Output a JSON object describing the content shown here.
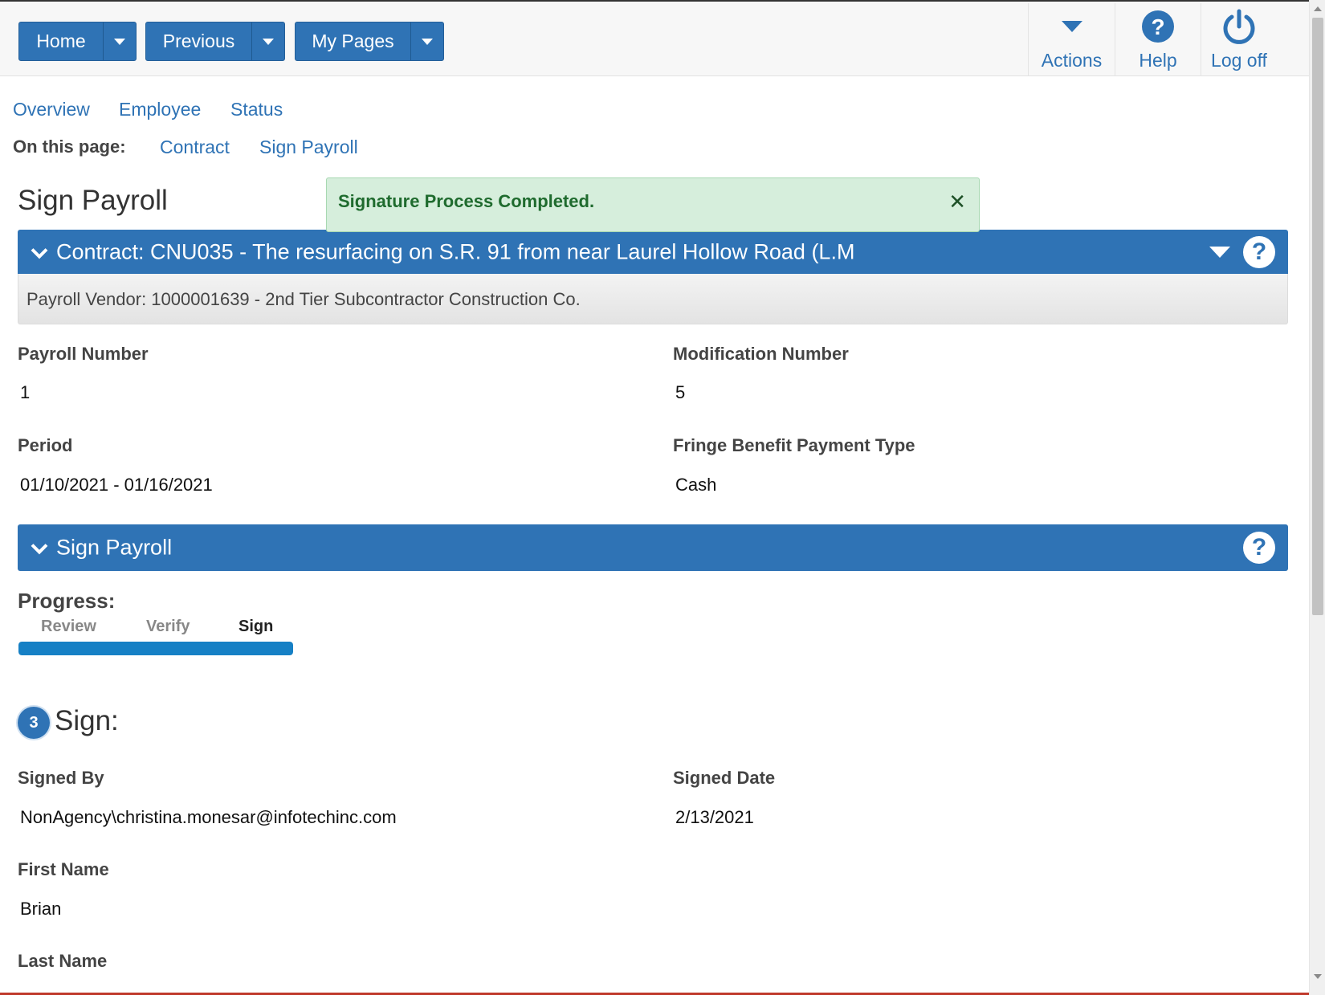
{
  "topbar": {
    "home_label": "Home",
    "previous_label": "Previous",
    "my_pages_label": "My Pages",
    "actions_label": "Actions",
    "help_label": "Help",
    "logoff_label": "Log off"
  },
  "nav": {
    "overview": "Overview",
    "employee": "Employee",
    "status": "Status",
    "on_this_page": "On this page:",
    "contract_link": "Contract",
    "sign_payroll_link": "Sign Payroll"
  },
  "page_title": "Sign Payroll",
  "alert": {
    "message": "Signature Process Completed.",
    "close_glyph": "✕",
    "color": "#1f6b2e"
  },
  "contract_panel": {
    "title": "Contract: CNU035 - The resurfacing on S.R. 91 from near Laurel Hollow Road (L.M",
    "vendor": "Payroll Vendor: 1000001639 - 2nd Tier Subcontractor Construction Co."
  },
  "fields": {
    "payroll_number_label": "Payroll Number",
    "payroll_number": "1",
    "modification_number_label": "Modification Number",
    "modification_number": "5",
    "period_label": "Period",
    "period": "01/10/2021 - 01/16/2021",
    "fringe_label": "Fringe Benefit Payment Type",
    "fringe": "Cash"
  },
  "sign_panel": {
    "title": "Sign Payroll",
    "progress_label": "Progress:",
    "steps": [
      "Review",
      "Verify",
      "Sign"
    ],
    "active_step": "Sign",
    "progress_fraction": 1.0,
    "step_number": "3",
    "sign_heading": "Sign:",
    "signed_by_label": "Signed By",
    "signed_by": "NonAgency\\christina.monesar@infotechinc.com",
    "signed_date_label": "Signed Date",
    "signed_date": "2/13/2021",
    "first_name_label": "First Name",
    "first_name": "Brian",
    "last_name_label": "Last Name"
  },
  "colors": {
    "brand_blue": "#2f73b5",
    "progress_blue": "#1680c5",
    "alert_bg": "#d6eedc"
  },
  "icons": [
    "chevron-down-icon",
    "caret-down-icon",
    "help-circle-icon",
    "power-icon",
    "close-icon"
  ]
}
